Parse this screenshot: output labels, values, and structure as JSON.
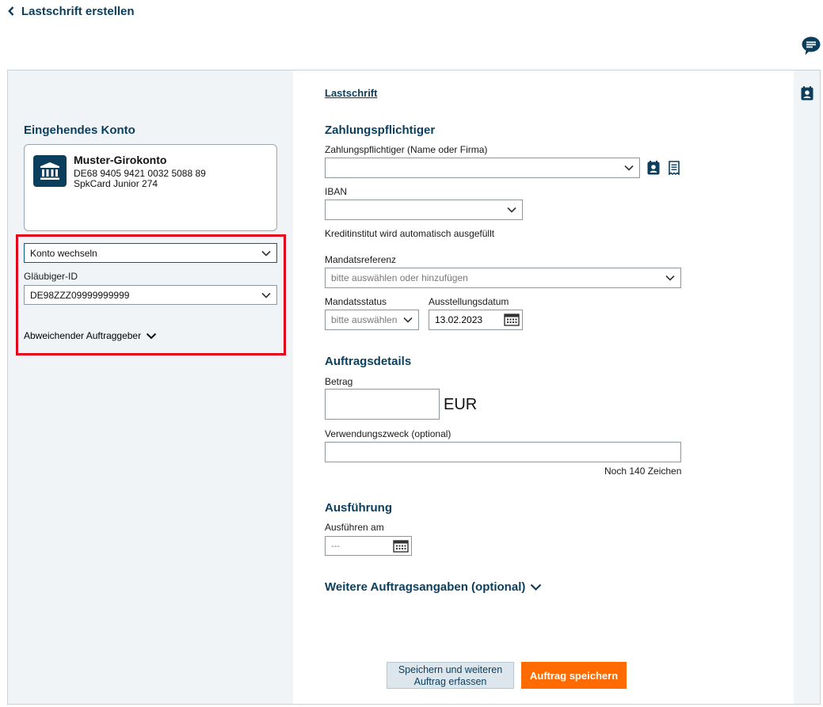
{
  "header": {
    "back_label": "Lastschrift erstellen"
  },
  "left": {
    "section_title": "Eingehendes Konto",
    "account": {
      "name": "Muster-Girokonto",
      "iban": "DE68 9405 9421 0032 5088 89",
      "card": "SpkCard Junior 274"
    },
    "switch_account": "Konto wechseln",
    "creditor_id_label": "Gläubiger-ID",
    "creditor_id_value": "DE98ZZZ09999999999",
    "different_originator": "Abweichender Auftraggeber"
  },
  "main": {
    "type_link": "Lastschrift",
    "payer_section": "Zahlungspflichtiger",
    "payer_label": "Zahlungspflichtiger (Name oder Firma)",
    "payer_value": "",
    "iban_label": "IBAN",
    "iban_value": "",
    "bank_hint": "Kreditinstitut wird automatisch ausgefüllt",
    "mandate_ref_label": "Mandatsreferenz",
    "mandate_ref_placeholder": "bitte auswählen oder hinzufügen",
    "mandate_status_label": "Mandatsstatus",
    "mandate_status_placeholder": "bitte auswählen",
    "issue_date_label": "Ausstellungsdatum",
    "issue_date_value": "13.02.2023",
    "order_section": "Auftragsdetails",
    "amount_label": "Betrag",
    "amount_value": "",
    "currency": "EUR",
    "purpose_label": "Verwendungszweck (optional)",
    "purpose_value": "",
    "chars_left": "Noch 140 Zeichen",
    "execution_section": "Ausführung",
    "execute_on_label": "Ausführen am",
    "execute_on_placeholder": "---",
    "more_details": "Weitere Auftragsangaben (optional)"
  },
  "buttons": {
    "save_and_new": "Speichern und weiteren Auftrag erfassen",
    "save": "Auftrag speichern"
  },
  "colors": {
    "primary_text": "#0b3e5c",
    "accent_orange": "#ff6b00",
    "highlight_red": "#e2001a"
  },
  "icons": [
    "chevron-left-icon",
    "chat-bubble-icon",
    "contact-card-icon",
    "bank-icon",
    "chevron-down-icon",
    "address-book-icon",
    "template-list-icon",
    "calendar-icon"
  ]
}
